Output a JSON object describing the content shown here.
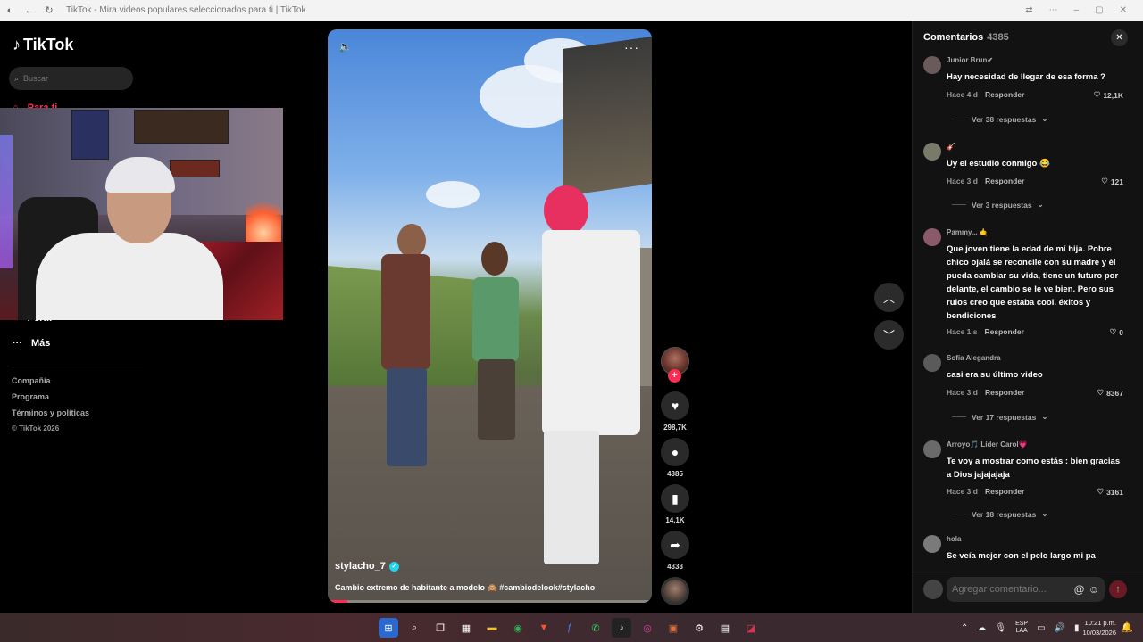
{
  "browser": {
    "title": "TikTok - Mira videos populares seleccionados para ti | TikTok"
  },
  "sidebar": {
    "logo_text": "TikTok",
    "search_placeholder": "Buscar",
    "partial_item_top": "Para ti",
    "partial_item_profile": "Perfil",
    "more_label": "Más",
    "links": [
      "Compañía",
      "Programa",
      "Términos y políticas"
    ],
    "copyright": "© TikTok 2026"
  },
  "video": {
    "author": "stylacho_7",
    "caption": "Cambio extremo de habitante a modelo 🙈 #cambiodelook#stylacho",
    "progress_fraction": 0.06
  },
  "actions": {
    "likes": "298,7K",
    "comments": "4385",
    "saves": "14,1K",
    "shares": "4333"
  },
  "comments_panel": {
    "title": "Comentarios",
    "count": "4385",
    "input_placeholder": "Agregar comentario...",
    "reply_label": "Responder",
    "items": [
      {
        "user": "Junior Brun✔",
        "text": "Hay necesidad de llegar de esa forma ?",
        "time": "Hace 4 d",
        "likes": "12,1K",
        "replies": "Ver 38 respuestas"
      },
      {
        "user": "🎸",
        "text": "Uy el estudio conmigo 😂",
        "time": "Hace 3 d",
        "likes": "121",
        "replies": "Ver 3 respuestas"
      },
      {
        "user": "Pammy... 🤙",
        "text": "Que joven tiene la edad de mí hija. Pobre chico ojalá se reconcile con su madre y él pueda cambiar su vida, tiene un futuro por delante, el cambio se le ve bien. Pero sus rulos creo que estaba cool. éxitos y bendiciones",
        "time": "Hace 1 s",
        "likes": "0",
        "replies": ""
      },
      {
        "user": "Sofía Alegandra",
        "text": "casi era su último video",
        "time": "Hace 3 d",
        "likes": "8367",
        "replies": "Ver 17 respuestas"
      },
      {
        "user": "Arroyo🎵 Líder Carol💗",
        "text": "Te voy a mostrar como estás : bien gracias a Dios jajajajaja",
        "time": "Hace 3 d",
        "likes": "3161",
        "replies": "Ver 18 respuestas"
      },
      {
        "user": "hola",
        "text": "Se veía mejor con el pelo largo mi pa",
        "time": "",
        "likes": "",
        "replies": ""
      }
    ]
  },
  "taskbar": {
    "lang_top": "ESP",
    "lang_bottom": "LAA",
    "time": "10:21 p.m.",
    "date": "10/03/2026"
  },
  "icons": {
    "like": "heart-icon",
    "comment": "chat-bubble-icon",
    "save": "bookmark-icon",
    "share": "share-arrow-icon"
  },
  "colors": {
    "accent": "#fe2c55",
    "verified": "#20d5ec"
  }
}
